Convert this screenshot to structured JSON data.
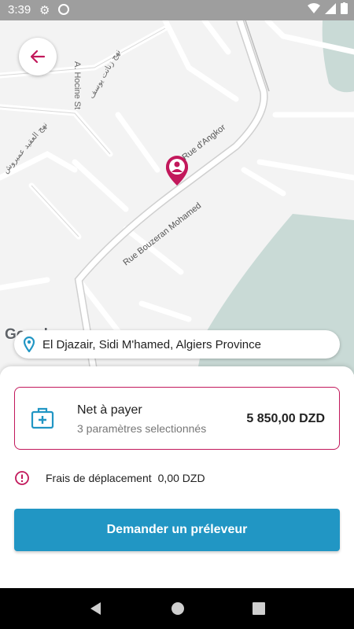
{
  "status_bar": {
    "time": "3:39"
  },
  "map": {
    "street_labels": [
      "A. Hocine St",
      "Rue Bouzeran Mohamed",
      "Rue d'Angkor",
      "نهج زناتت يوسف",
      "نهج العقيد عميروش"
    ],
    "attribution": "Google"
  },
  "address": {
    "text": "El Djazair, Sidi M'hamed, Algiers Province"
  },
  "payment": {
    "title": "Net à payer",
    "subtitle": "3 paramètres selectionnés",
    "amount": "5 850,00 DZD"
  },
  "fees": {
    "label": "Frais de déplacement",
    "value": "0,00 DZD"
  },
  "actions": {
    "request_label": "Demander un préleveur"
  },
  "colors": {
    "accent": "#c2185b",
    "primary_button": "#2196c4",
    "map_water": "#c9dad6"
  }
}
